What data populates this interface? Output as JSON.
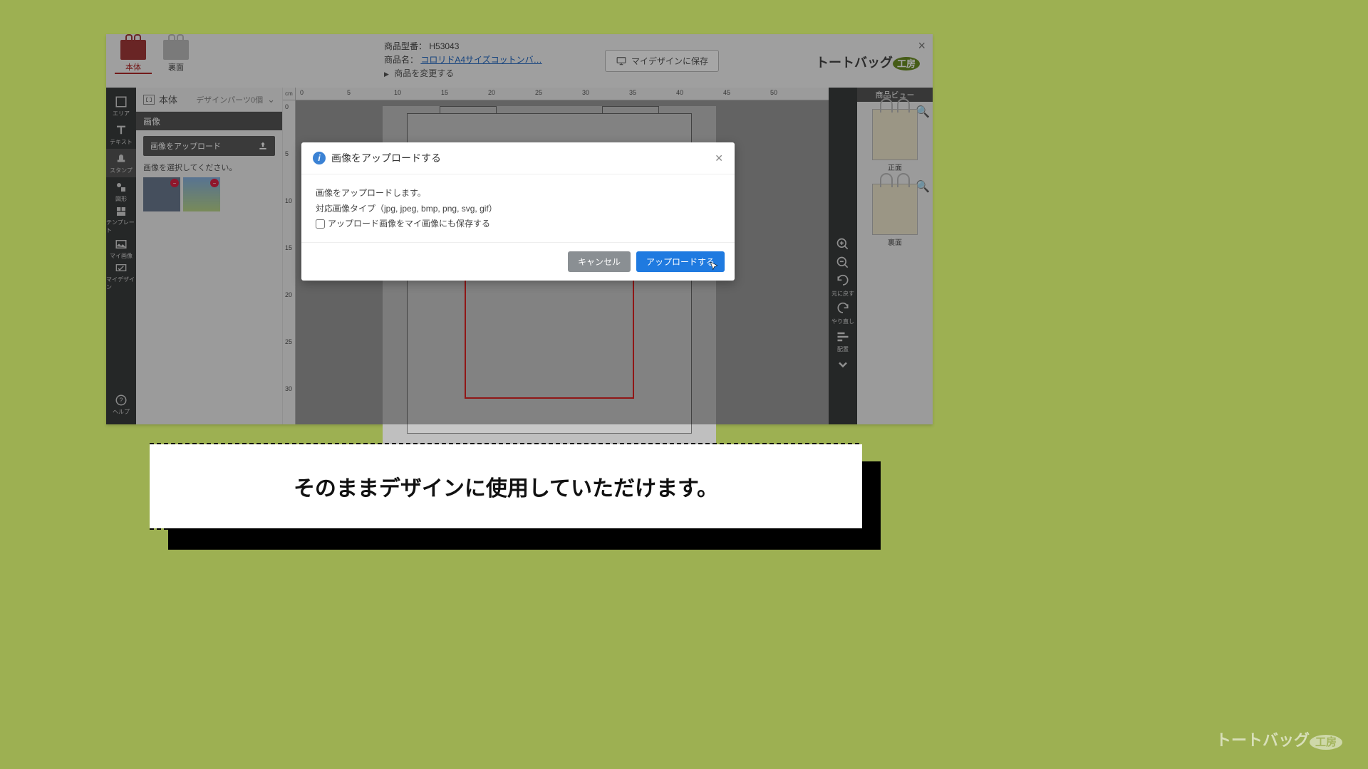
{
  "window": {
    "close": "×"
  },
  "topbar": {
    "tabs": {
      "front": "本体",
      "back": "裏面"
    },
    "product": {
      "model_label": "商品型番：",
      "model_value": "H53043",
      "name_label": "商品名：",
      "name_link": "コロリドA4サイズコットンバ…",
      "change": "商品を変更する"
    },
    "save_btn": "マイデザインに保存",
    "brand_a": "トートバッグ",
    "brand_b": "工房"
  },
  "left_rail": {
    "area": "エリア",
    "text": "テキスト",
    "stamp": "スタンプ",
    "shape": "図形",
    "template": "テンプレート",
    "myimage": "マイ画像",
    "mydesign": "マイデザイン",
    "help": "ヘルプ"
  },
  "side": {
    "head": "本体",
    "parts": "デザインパーツ0個",
    "sec": "画像",
    "upload": "画像をアップロード",
    "note": "画像を選択してください。"
  },
  "ruler": {
    "cm": "cm",
    "h": [
      "0",
      "5",
      "10",
      "15",
      "20",
      "25",
      "30",
      "35",
      "40",
      "45",
      "50"
    ],
    "v": [
      "0",
      "5",
      "10",
      "15",
      "20",
      "25",
      "30"
    ]
  },
  "right": {
    "header": "商品ビュー",
    "front": "正面",
    "back": "裏面",
    "undo": "元に戻す",
    "redo": "やり直し",
    "align": "配置"
  },
  "modal": {
    "title": "画像をアップロードする",
    "line1": "画像をアップロードします。",
    "line2": "対応画像タイプ（jpg, jpeg, bmp, png, svg, gif）",
    "checkbox": "アップロード画像をマイ画像にも保存する",
    "cancel": "キャンセル",
    "submit": "アップロードする",
    "close": "✕"
  },
  "caption": "そのままデザインに使用していただけます。",
  "corner": {
    "a": "トートバッグ",
    "b": "工房"
  }
}
